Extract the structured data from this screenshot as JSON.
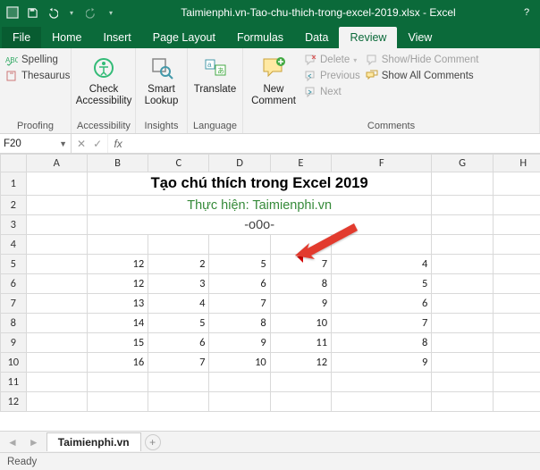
{
  "window": {
    "title": "Taimienphi.vn-Tao-chu-thich-trong-excel-2019.xlsx - Excel"
  },
  "tabs": {
    "file": "File",
    "home": "Home",
    "insert": "Insert",
    "pagelayout": "Page Layout",
    "formulas": "Formulas",
    "data": "Data",
    "review": "Review",
    "view": "View"
  },
  "ribbon": {
    "proofing": {
      "spelling": "Spelling",
      "thesaurus": "Thesaurus",
      "label": "Proofing"
    },
    "accessibility": {
      "button": "Check\nAccessibility",
      "label": "Accessibility"
    },
    "insights": {
      "button": "Smart\nLookup",
      "label": "Insights"
    },
    "language": {
      "button": "Translate",
      "label": "Language"
    },
    "comments": {
      "new": "New\nComment",
      "delete": "Delete",
      "previous": "Previous",
      "next": "Next",
      "showhide": "Show/Hide Comment",
      "showall": "Show All Comments",
      "label": "Comments"
    }
  },
  "formulaBar": {
    "nameBox": "F20"
  },
  "sheet": {
    "columns": [
      "A",
      "B",
      "C",
      "D",
      "E",
      "F",
      "G",
      "H"
    ],
    "rowCount": 12,
    "title": "Tạo chú thích trong Excel 2019",
    "subtitle": "Thực hiện: Taimienphi.vn",
    "ooo": "-o0o-",
    "data": {
      "5": {
        "B": "12",
        "C": "2",
        "D": "5",
        "E": "7",
        "F": "4"
      },
      "6": {
        "B": "12",
        "C": "3",
        "D": "6",
        "E": "8",
        "F": "5"
      },
      "7": {
        "B": "13",
        "C": "4",
        "D": "7",
        "E": "9",
        "F": "6"
      },
      "8": {
        "B": "14",
        "C": "5",
        "D": "8",
        "E": "10",
        "F": "7"
      },
      "9": {
        "B": "15",
        "C": "6",
        "D": "9",
        "E": "11",
        "F": "8"
      },
      "10": {
        "B": "16",
        "C": "7",
        "D": "10",
        "E": "12",
        "F": "9"
      }
    }
  },
  "sheetTab": "Taimienphi.vn",
  "status": "Ready",
  "selectedCell": "F20"
}
